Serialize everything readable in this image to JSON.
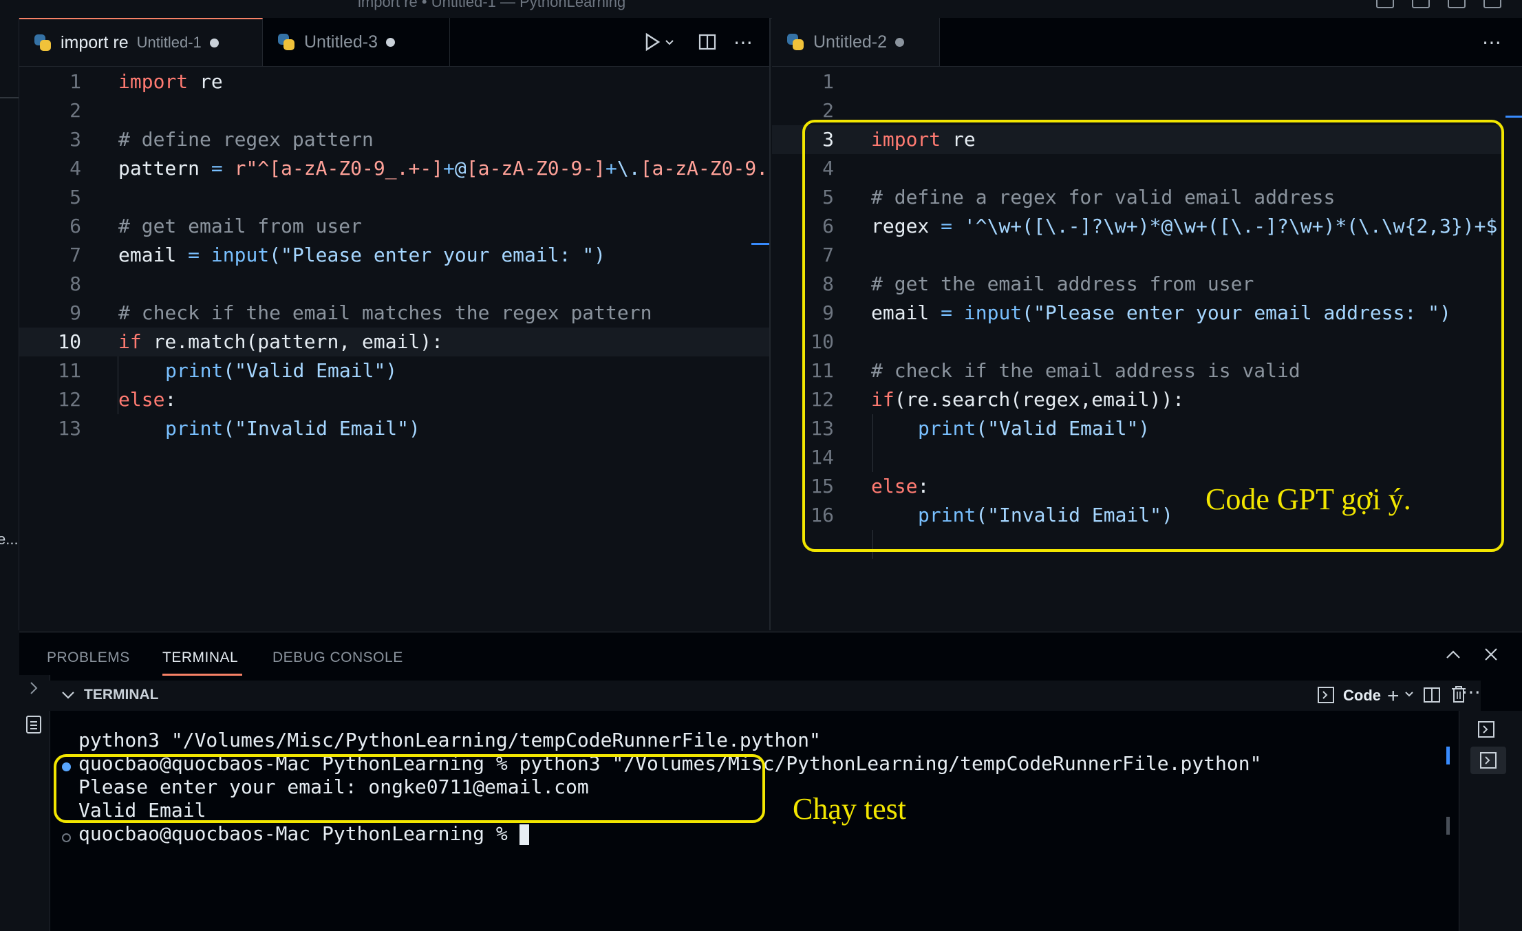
{
  "window": {
    "title": "import re • Untitled-1 — PythonLearning"
  },
  "left_editor": {
    "tabs": [
      {
        "label": "import re",
        "sub": "Untitled-1"
      },
      {
        "label": "Untitled-3",
        "sub": ""
      }
    ],
    "line_numbers": [
      "1",
      "2",
      "3",
      "4",
      "5",
      "6",
      "7",
      "8",
      "9",
      "10",
      "11",
      "12",
      "13"
    ],
    "code": {
      "l1_kw": "import",
      "l1_rest": " re",
      "l3": "# define regex pattern",
      "l4_var": "pattern",
      "l4_eq": " = ",
      "l4_prefix": "r\"",
      "l4_a": "^[a-zA-Z0-9_.+-]",
      "l4_b": "+",
      "l4_c": "@",
      "l4_d": "[a-zA-Z0-9-]",
      "l4_e": "+",
      "l4_f": "\\.",
      "l4_g": "[a-zA-Z0-9.",
      "l6": "# get email from user",
      "l7_var": "email",
      "l7_eq": " = ",
      "l7_fn": "input",
      "l7_str": "(\"Please enter your email: \")",
      "l9": "# check if the email matches the regex pattern",
      "l10_kw": "if",
      "l10_rest": " re.match",
      "l10_args": "(pattern, email):",
      "l11_fn": "print",
      "l11_str": "(\"Valid Email\")",
      "l12_kw": "else",
      "l12_rest": ":",
      "l13_fn": "print",
      "l13_str": "(\"Invalid Email\")"
    }
  },
  "right_editor": {
    "tabs": [
      {
        "label": "Untitled-2"
      }
    ],
    "line_numbers": [
      "1",
      "2",
      "3",
      "4",
      "5",
      "6",
      "7",
      "8",
      "9",
      "10",
      "11",
      "12",
      "13",
      "14",
      "15",
      "16"
    ],
    "code": {
      "l3_kw": "import",
      "l3_rest": " re",
      "l5": "# define a regex for valid email address",
      "l6_var": "regex",
      "l6_eq": " = ",
      "l6_str": "'^\\w+([\\.-]?\\w+)*@\\w+([\\.-]?\\w+)*(\\.\\w{2,3})+$'",
      "l8": "# get the email address from user",
      "l9_var": "email",
      "l9_eq": " = ",
      "l9_fn": "input",
      "l9_str": "(\"Please enter your email address: \")",
      "l11": "# check if the email address is valid",
      "l12_kw": "if",
      "l12_rest": "(re.search(regex,email)):",
      "l13_fn": "print",
      "l13_str": "(\"Valid Email\")",
      "l15_kw": "else",
      "l15_rest": ":",
      "l16_fn": "print",
      "l16_str": "(\"Invalid Email\")"
    },
    "annotation": "Code GPT gợi ý."
  },
  "panel": {
    "tabs": [
      "PROBLEMS",
      "TERMINAL",
      "DEBUG CONSOLE"
    ],
    "terminal_title": "TERMINAL",
    "shell_label": "Code",
    "lines": [
      "python3 \"/Volumes/Misc/PythonLearning/tempCodeRunnerFile.python\"",
      "quocbao@quocbaos-Mac PythonLearning % python3 \"/Volumes/Misc/PythonLearning/tempCodeRunnerFile.python\"",
      "Please enter your email: ongke0711@email.com",
      "Valid Email",
      "quocbao@quocbaos-Mac PythonLearning % "
    ],
    "annotation": "Chạy test"
  },
  "sidebar_fragment": "e..."
}
